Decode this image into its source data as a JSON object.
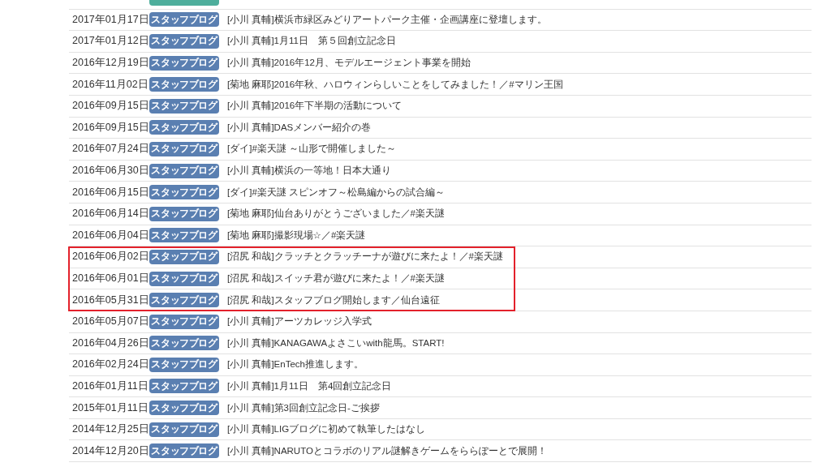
{
  "entries": [
    {
      "kind": "press",
      "highlighted": false
    },
    {
      "date": "2017年01月17日",
      "kind": "staff",
      "category": "スタッフブログ",
      "title": "[小川 真輔]横浜市緑区みどりアートパーク主催・企画講座に登壇します。",
      "highlighted": false
    },
    {
      "date": "2017年01月12日",
      "kind": "staff",
      "category": "スタッフブログ",
      "title": "[小川 真輔]1月11日　第５回創立記念日",
      "highlighted": false
    },
    {
      "date": "2016年12月19日",
      "kind": "staff",
      "category": "スタッフブログ",
      "title": "[小川 真輔]2016年12月、モデルエージェント事業を開始",
      "highlighted": false
    },
    {
      "date": "2016年11月02日",
      "kind": "staff",
      "category": "スタッフブログ",
      "title": "[菊地 麻耶]2016年秋、ハロウィンらしいことをしてみました！／#マリン王国",
      "highlighted": false
    },
    {
      "date": "2016年09月15日",
      "kind": "staff",
      "category": "スタッフブログ",
      "title": "[小川 真輔]2016年下半期の活動について",
      "highlighted": false
    },
    {
      "date": "2016年09月15日",
      "kind": "staff",
      "category": "スタッフブログ",
      "title": "[小川 真輔]DASメンバー紹介の巻",
      "highlighted": false
    },
    {
      "date": "2016年07月24日",
      "kind": "staff",
      "category": "スタッフブログ",
      "title": "[ダイ]#楽天謎 ～山形で開催しました～",
      "highlighted": false
    },
    {
      "date": "2016年06月30日",
      "kind": "staff",
      "category": "スタッフブログ",
      "title": "[小川 真輔]横浜の一等地！日本大通り",
      "highlighted": false
    },
    {
      "date": "2016年06月15日",
      "kind": "staff",
      "category": "スタッフブログ",
      "title": "[ダイ]#楽天謎 スピンオフ～松島編からの試合編～",
      "highlighted": false
    },
    {
      "date": "2016年06月14日",
      "kind": "staff",
      "category": "スタッフブログ",
      "title": "[菊地 麻耶]仙台ありがとうございました／#楽天謎",
      "highlighted": false
    },
    {
      "date": "2016年06月04日",
      "kind": "staff",
      "category": "スタッフブログ",
      "title": "[菊地 麻耶]撮影現場☆／#楽天謎",
      "highlighted": false
    },
    {
      "date": "2016年06月02日",
      "kind": "staff",
      "category": "スタッフブログ",
      "title": "[沼尻 和哉]クラッチとクラッチーナが遊びに来たよ！／#楽天謎",
      "highlighted": true
    },
    {
      "date": "2016年06月01日",
      "kind": "staff",
      "category": "スタッフブログ",
      "title": "[沼尻 和哉]スイッチ君が遊びに来たよ！／#楽天謎",
      "highlighted": true
    },
    {
      "date": "2016年05月31日",
      "kind": "staff",
      "category": "スタッフブログ",
      "title": "[沼尻 和哉]スタッフブログ開始します／仙台遠征",
      "highlighted": true
    },
    {
      "date": "2016年05月07日",
      "kind": "staff",
      "category": "スタッフブログ",
      "title": "[小川 真輔]アーツカレッジ入学式",
      "highlighted": false
    },
    {
      "date": "2016年04月26日",
      "kind": "staff",
      "category": "スタッフブログ",
      "title": "[小川 真輔]KANAGAWAよさこいwith龍馬。START!",
      "highlighted": false
    },
    {
      "date": "2016年02月24日",
      "kind": "staff",
      "category": "スタッフブログ",
      "title": "[小川 真輔]EnTech推進します。",
      "highlighted": false
    },
    {
      "date": "2016年01月11日",
      "kind": "staff",
      "category": "スタッフブログ",
      "title": "[小川 真輔]1月11日　第4回創立記念日",
      "highlighted": false
    },
    {
      "date": "2015年01月11日",
      "kind": "staff",
      "category": "スタッフブログ",
      "title": "[小川 真輔]第3回創立記念日-ご挨拶",
      "highlighted": false
    },
    {
      "date": "2014年12月25日",
      "kind": "staff",
      "category": "スタッフブログ",
      "title": "[小川 真輔]LIGブログに初めて執筆したはなし",
      "highlighted": false
    },
    {
      "date": "2014年12月20日",
      "kind": "staff",
      "category": "スタッフブログ",
      "title": "[小川 真輔]NARUTOとコラボのリアル謎解きゲームをららぽーとで展開！",
      "highlighted": false
    }
  ]
}
